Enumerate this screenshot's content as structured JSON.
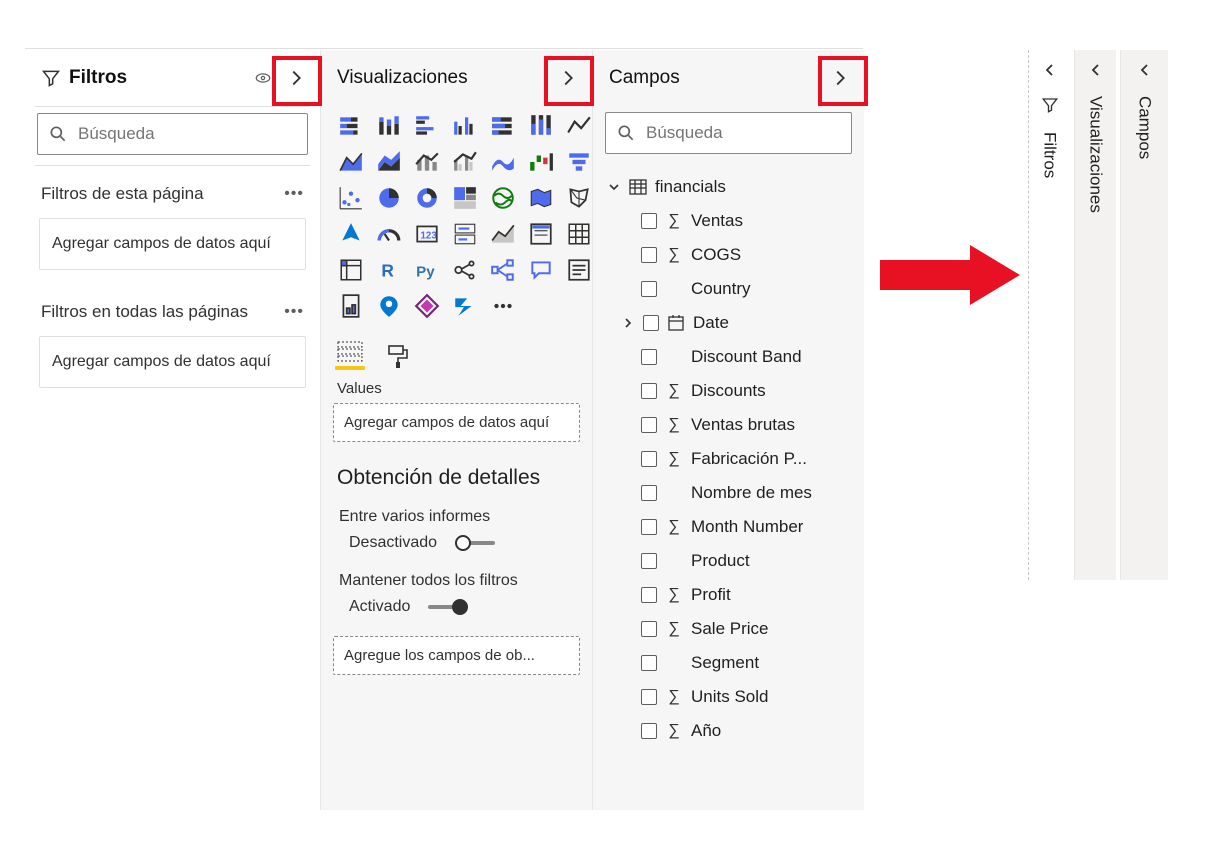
{
  "filters": {
    "title": "Filtros",
    "search_placeholder": "Búsqueda",
    "page_filters_label": "Filtros de esta página",
    "all_pages_filters_label": "Filtros en todas las páginas",
    "drop_text": "Agregar campos de datos aquí"
  },
  "viz": {
    "title": "Visualizaciones",
    "values_label": "Values",
    "drop_text": "Agregar campos de datos aquí",
    "drill_heading": "Obtención de detalles",
    "cross_report_label": "Entre varios informes",
    "cross_report_state": "Desactivado",
    "keep_all_label": "Mantener todos los filtros",
    "keep_all_state": "Activado",
    "drill_drop_text": "Agregue los campos de ob..."
  },
  "fields": {
    "title": "Campos",
    "search_placeholder": "Búsqueda",
    "table": "financials",
    "items": [
      {
        "name": "Ventas",
        "sigma": true,
        "type": "num"
      },
      {
        "name": "COGS",
        "sigma": true,
        "type": "num"
      },
      {
        "name": "Country",
        "sigma": false,
        "type": "text"
      },
      {
        "name": "Date",
        "sigma": false,
        "type": "date",
        "expandable": true
      },
      {
        "name": "Discount Band",
        "sigma": false,
        "type": "text"
      },
      {
        "name": "Discounts",
        "sigma": true,
        "type": "num"
      },
      {
        "name": "Ventas brutas",
        "sigma": true,
        "type": "num"
      },
      {
        "name": "Fabricación P...",
        "sigma": true,
        "type": "num"
      },
      {
        "name": "Nombre de mes",
        "sigma": false,
        "type": "text"
      },
      {
        "name": "Month Number",
        "sigma": true,
        "type": "num"
      },
      {
        "name": "Product",
        "sigma": false,
        "type": "text"
      },
      {
        "name": "Profit",
        "sigma": true,
        "type": "num"
      },
      {
        "name": "Sale Price",
        "sigma": true,
        "type": "num"
      },
      {
        "name": "Segment",
        "sigma": false,
        "type": "text"
      },
      {
        "name": "Units Sold",
        "sigma": true,
        "type": "num"
      },
      {
        "name": "Año",
        "sigma": true,
        "type": "num"
      }
    ]
  },
  "collapsed": {
    "filters": "Filtros",
    "viz": "Visualizaciones",
    "fields": "Campos"
  }
}
